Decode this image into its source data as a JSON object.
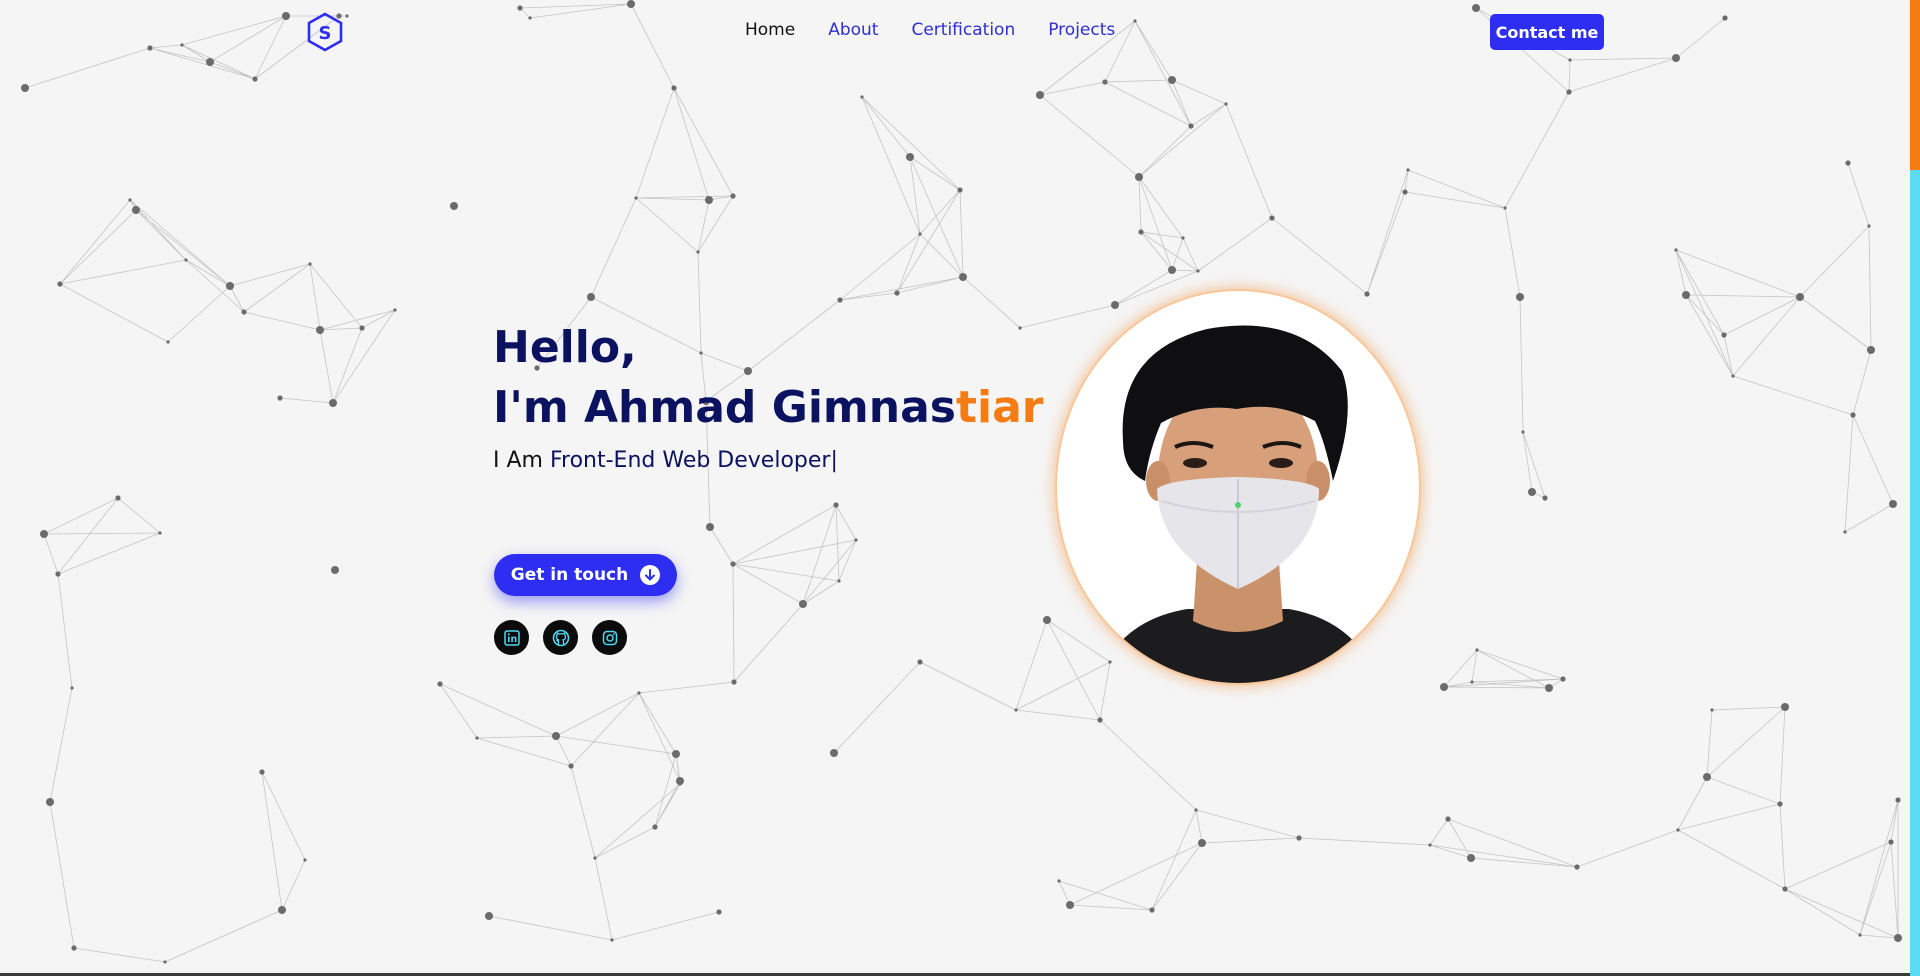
{
  "colors": {
    "background": "#f5f5f5",
    "primary": "#2d2ef2",
    "heading": "#0b1260",
    "accent": "#f47c12",
    "scrollbar_thumb": "#f47c12",
    "scrollbar_track": "#5bdcf4"
  },
  "logo": {
    "letter": "S",
    "icon": "hexagon-logo-icon"
  },
  "nav": {
    "items": [
      {
        "label": "Home",
        "active": true
      },
      {
        "label": "About"
      },
      {
        "label": "Certification"
      },
      {
        "label": "Projects"
      }
    ],
    "contact_label": "Contact me"
  },
  "hero": {
    "greeting": "Hello,",
    "name_prefix": "I'm Ahmad Gimnas",
    "name_accent": "tiar",
    "role_prefix": "I Am ",
    "role": "Front-End Web Developer",
    "cursor": "|",
    "cta_label": "Get in touch",
    "cta_icon": "arrow-down-circle-icon"
  },
  "socials": [
    {
      "name": "linkedin",
      "icon": "linkedin-icon"
    },
    {
      "name": "github",
      "icon": "github-icon"
    },
    {
      "name": "instagram",
      "icon": "instagram-icon"
    }
  ],
  "portrait": {
    "description_icon": "profile-photo"
  }
}
